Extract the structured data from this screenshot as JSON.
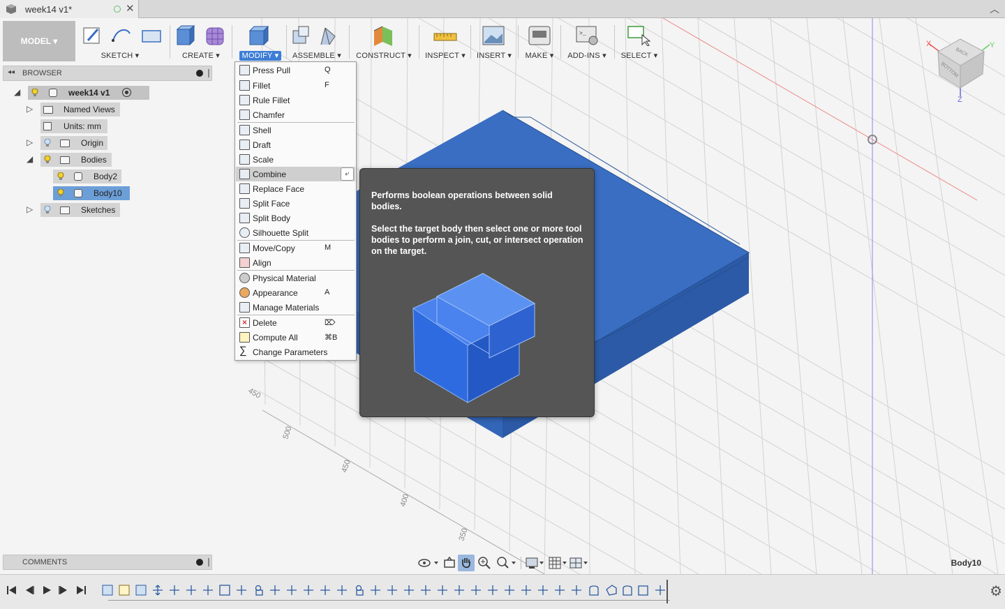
{
  "tab": {
    "title": "week14 v1*",
    "close": "✕"
  },
  "toolbar": {
    "model": "MODEL",
    "groups": [
      {
        "label": "SKETCH"
      },
      {
        "label": "CREATE"
      },
      {
        "label": "MODIFY"
      },
      {
        "label": "ASSEMBLE"
      },
      {
        "label": "CONSTRUCT"
      },
      {
        "label": "INSPECT"
      },
      {
        "label": "INSERT"
      },
      {
        "label": "MAKE"
      },
      {
        "label": "ADD-INS"
      },
      {
        "label": "SELECT"
      }
    ]
  },
  "browser": {
    "title": "BROWSER",
    "items": [
      {
        "label": "week14 v1"
      },
      {
        "label": "Named Views"
      },
      {
        "label": "Units: mm"
      },
      {
        "label": "Origin"
      },
      {
        "label": "Bodies"
      },
      {
        "label": "Body2"
      },
      {
        "label": "Body10"
      },
      {
        "label": "Sketches"
      }
    ]
  },
  "modify_menu": {
    "items": [
      {
        "label": "Press Pull",
        "key": "Q"
      },
      {
        "label": "Fillet",
        "key": "F"
      },
      {
        "label": "Rule Fillet",
        "key": ""
      },
      {
        "label": "Chamfer",
        "key": ""
      },
      {
        "label": "Shell",
        "key": ""
      },
      {
        "label": "Draft",
        "key": ""
      },
      {
        "label": "Scale",
        "key": ""
      },
      {
        "label": "Combine",
        "key": ""
      },
      {
        "label": "Replace Face",
        "key": ""
      },
      {
        "label": "Split Face",
        "key": ""
      },
      {
        "label": "Split Body",
        "key": ""
      },
      {
        "label": "Silhouette Split",
        "key": ""
      },
      {
        "label": "Move/Copy",
        "key": "M"
      },
      {
        "label": "Align",
        "key": ""
      },
      {
        "label": "Physical Material",
        "key": ""
      },
      {
        "label": "Appearance",
        "key": "A"
      },
      {
        "label": "Manage Materials",
        "key": ""
      },
      {
        "label": "Delete",
        "key": "⌦"
      },
      {
        "label": "Compute All",
        "key": "⌘B"
      },
      {
        "label": "Change Parameters",
        "key": ""
      }
    ]
  },
  "tooltip": {
    "heading": "Performs boolean operations between solid bodies.",
    "body": "Select the target body then select one or more tool bodies to perform a join, cut, or intersect operation on the target."
  },
  "viewcube": {
    "back": "BACK",
    "bottom": "BOTTOM",
    "x": "X",
    "y": "Y",
    "z": "Z"
  },
  "grid_labels": {
    "l1": "450",
    "l2": "500",
    "l3": "450",
    "l4": "400",
    "l5": "350"
  },
  "comments": {
    "title": "COMMENTS"
  },
  "status": {
    "selected_body": "Body10"
  },
  "colors": {
    "body": "#3366b8",
    "accent": "#3d7dd6"
  }
}
